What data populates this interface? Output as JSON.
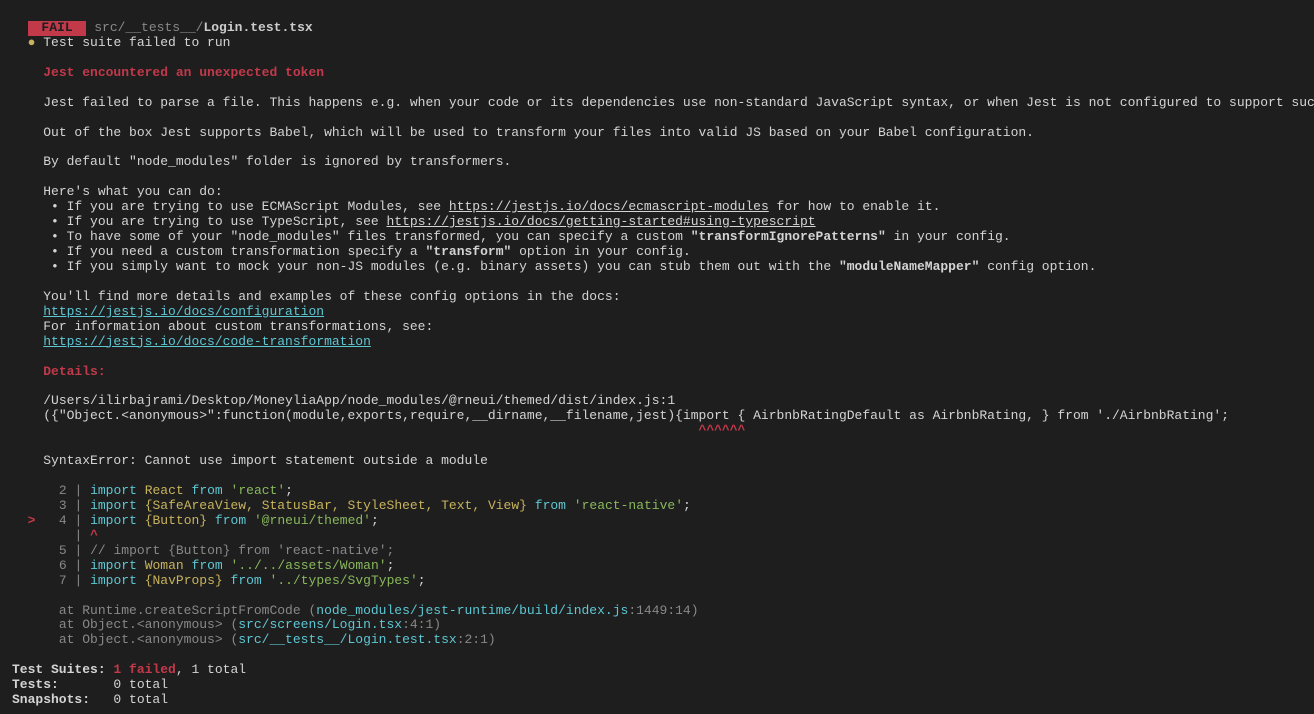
{
  "header": {
    "badge": " FAIL ",
    "path": "src/__tests__/",
    "file": "Login.test.tsx",
    "failedRun": "Test suite failed to run"
  },
  "section": {
    "unexpectedToken": "Jest encountered an unexpected token",
    "parseFail": "Jest failed to parse a file. This happens e.g. when your code or its dependencies use non-standard JavaScript syntax, or when Jest is not configured to support such syntax.",
    "babel": "Out of the box Jest supports Babel, which will be used to transform your files into valid JS based on your Babel configuration.",
    "nodeModules": "By default \"node_modules\" folder is ignored by transformers.",
    "whatYouCanDo": "Here's what you can do:",
    "bullets": {
      "b1a": " • If you are trying to use ECMAScript Modules, see ",
      "b1link": "https://jestjs.io/docs/ecmascript-modules",
      "b1b": " for how to enable it.",
      "b2a": " • If you are trying to use TypeScript, see ",
      "b2link": "https://jestjs.io/docs/getting-started#using-typescript",
      "b3a": " • To have some of your \"node_modules\" files transformed, you can specify a custom ",
      "b3bold": "\"transformIgnorePatterns\"",
      "b3b": " in your config.",
      "b4a": " • If you need a custom transformation specify a ",
      "b4bold": "\"transform\"",
      "b4b": " option in your config.",
      "b5a": " • If you simply want to mock your non-JS modules (e.g. binary assets) you can stub them out with the ",
      "b5bold": "\"moduleNameMapper\"",
      "b5b": " config option."
    },
    "moreDetails": "You'll find more details and examples of these config options in the docs:",
    "configLink": "https://jestjs.io/docs/configuration",
    "customTrans": "For information about custom transformations, see:",
    "codeTransLink": "https://jestjs.io/docs/code-transformation",
    "detailsLabel": "Details:",
    "errPath": "/Users/ilirbajrami/Desktop/MoneyliaApp/node_modules/@rneui/themed/dist/index.js:1",
    "errCode": "({\"Object.<anonymous>\":function(module,exports,require,__dirname,__filename,jest){import { AirbnbRatingDefault as AirbnbRating, } from './AirbnbRating';",
    "caretLine": "                                                                                    ^^^^^^",
    "syntaxError": "SyntaxError: Cannot use import statement outside a module"
  },
  "code": {
    "l2": {
      "num": "  2 "
    },
    "l3": {
      "num": "  3 "
    },
    "l4": {
      "num": "  4 ",
      "gt": "> "
    },
    "lcaret": {
      "num": "    "
    },
    "l5": {
      "num": "  5 "
    },
    "l6": {
      "num": "  6 "
    },
    "l7": {
      "num": "  7 "
    },
    "react": "React",
    "reactStr": "'react'",
    "safeArea": "{SafeAreaView, StatusBar, StyleSheet, Text, View}",
    "rnStr": "'react-native'",
    "button": "{Button}",
    "rneuiStr": "'@rneui/themed'",
    "commentLine": "// import {Button} from 'react-native';",
    "woman": "Woman",
    "womanStr": "'../../assets/Woman'",
    "navProps": "{NavProps}",
    "svgStr": "'../types/SvgTypes'",
    "kwImport": "import",
    "kwFrom": "from",
    "semi": ";",
    "caret": "^"
  },
  "stack": {
    "at": "at",
    "s1a": " Runtime.createScriptFromCode (",
    "s1path": "node_modules/jest-runtime/build/index.js",
    "s1loc": ":1449:14)",
    "s2a": " Object.<anonymous> (",
    "s2path": "src/screens/Login.tsx",
    "s2loc": ":4:1)",
    "s3a": " Object.<anonymous> (",
    "s3path": "src/__tests__/Login.test.tsx",
    "s3loc": ":2:1)"
  },
  "summary": {
    "suitesLabel": "Test Suites: ",
    "suitesFail": "1 failed",
    "suitesTotal": ", 1 total",
    "testsLabel": "Tests:       ",
    "testsTotal": "0 total",
    "snapLabel": "Snapshots:   ",
    "snapTotal": "0 total"
  }
}
